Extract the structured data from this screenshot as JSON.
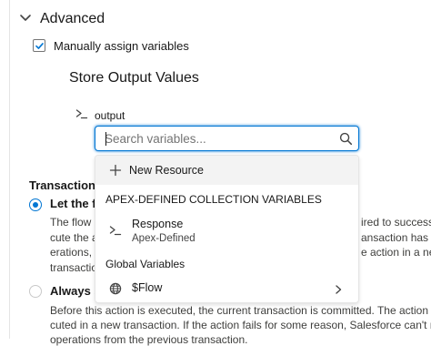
{
  "section": {
    "title": "Advanced"
  },
  "manual_assign": {
    "label": "Manually assign variables",
    "checked": true
  },
  "store_output": {
    "heading": "Store Output Values",
    "output_label": "output",
    "search_placeholder": "Search variables..."
  },
  "dropdown": {
    "new_resource_label": "New Resource",
    "groups": [
      {
        "header": "APEX-DEFINED COLLECTION VARIABLES",
        "items": [
          {
            "title": "Response",
            "subtitle": "Apex-Defined",
            "icon": "terminal-icon"
          }
        ]
      },
      {
        "header": "Global Variables",
        "items": [
          {
            "title": "$Flow",
            "icon": "globe-icon",
            "has_submenu": true
          }
        ]
      }
    ]
  },
  "transaction": {
    "heading_visible": "Transaction C",
    "option1_label_visible": "Let the f",
    "option1_desc_lines": [
      {
        "left": "The flow c",
        "right": "ired to success"
      },
      {
        "left": "cute the a",
        "right": "ansaction has pe"
      },
      {
        "left": "erations, t",
        "right": "e action in a new"
      },
      {
        "left": "transactio",
        "right": ""
      }
    ],
    "option2_label_visible": "Always s",
    "option2_desc_lines": [
      "Before this action is executed, the current transaction is committed. The action is",
      "cuted in a new transaction. If the action fails for some reason, Salesforce can't rol",
      "operations from the previous transaction."
    ]
  },
  "colors": {
    "accent": "#0176d3",
    "text": "#181818",
    "hover_bg": "#f3f3f3"
  }
}
